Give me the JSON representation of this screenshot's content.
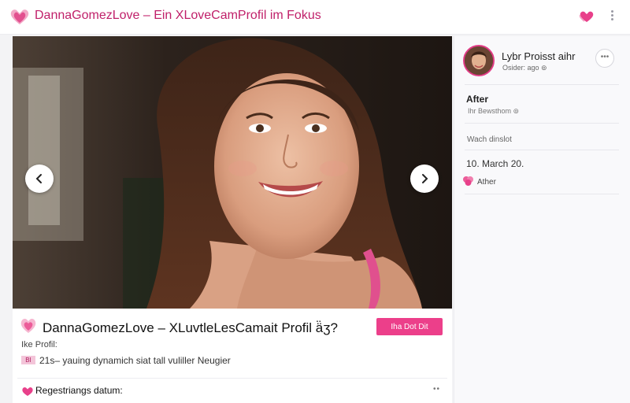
{
  "header": {
    "title": "DannaGomezLove – Ein XLoveCamProfil im Fokus",
    "logo_icon": "heart-logo-icon",
    "favorite_icon": "heart-icon",
    "more_icon": "more-vertical-icon"
  },
  "gallery": {
    "prev_icon": "chevron-left-icon",
    "next_icon": "chevron-right-icon"
  },
  "card": {
    "title": "DannaGomezLove – XLuvtleLesCamait Profil ä̈ʒ?",
    "cta_label": "Iha Dot Dit",
    "profil_label": "Ike Profil:",
    "age_badge": "BI",
    "bio": "21s– yauing dynamich siat tall vuliller Neugier",
    "reg_label": "Regestriangs datum:",
    "reg_dots": "••"
  },
  "sidebar": {
    "name": "Lybr Proisst aihr",
    "meta": "Osider:   ago ⊚",
    "menu_label": "•••",
    "section1_title": "After",
    "section1_sub": "Ihr Bewsthom ⊚",
    "section2_label": "Wach dinslot",
    "date": "10. March 20.",
    "tag": "Ather"
  },
  "colors": {
    "brand": "#c0206a",
    "accent": "#ec3f8a",
    "avatar_ring": "#e23c86"
  }
}
